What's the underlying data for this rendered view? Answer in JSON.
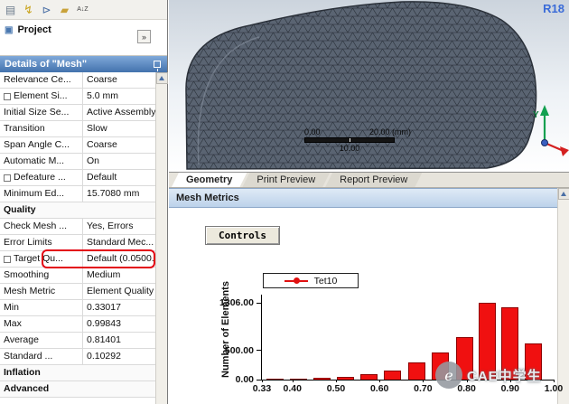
{
  "colors": {
    "details_header": "#4372ad",
    "highlight_box": "#e30613",
    "bar_color": "#f01010",
    "legend_line": "#e01010",
    "version_text": "#3a6bd8",
    "triad_y": "#12a050",
    "triad_x": "#d42020"
  },
  "toolbar": {
    "icons": [
      {
        "name": "worksheet-icon",
        "glyph": "▤",
        "color": "#6a7a8a",
        "size": 12
      },
      {
        "name": "solve-lightning-icon",
        "glyph": "↯",
        "color": "#caa41e",
        "size": 13
      },
      {
        "name": "show-errors-icon",
        "glyph": "⊳",
        "color": "#4a6fa5",
        "size": 12
      },
      {
        "name": "folder-icon",
        "glyph": "▰",
        "color": "#c9a23a",
        "size": 12
      },
      {
        "name": "az-sort-icon",
        "glyph": "A↓Z",
        "color": "#444444",
        "size": 7
      }
    ]
  },
  "outline": {
    "root_label": "Project",
    "expand_glyph": "»"
  },
  "details": {
    "title": "Details of \"Mesh\"",
    "rows": [
      {
        "label": "Relevance Ce...",
        "value": "Coarse"
      },
      {
        "label": "Element Si...",
        "value": "5.0 mm",
        "checkbox": true
      },
      {
        "label": "Initial Size Se...",
        "value": "Active Assembly"
      },
      {
        "label": "Transition",
        "value": "Slow"
      },
      {
        "label": "Span Angle C...",
        "value": "Coarse"
      },
      {
        "label": "Automatic M...",
        "value": "On"
      },
      {
        "label": "Defeature ...",
        "value": "Default",
        "checkbox": true
      },
      {
        "label": "Minimum Ed...",
        "value": "15.7080 mm"
      },
      {
        "label": "Quality",
        "section": true
      },
      {
        "label": "Check Mesh ...",
        "value": "Yes, Errors"
      },
      {
        "label": "Error Limits",
        "value": "Standard Mec..."
      },
      {
        "label": "Target Qu...",
        "value": "Default (0.0500...",
        "checkbox": true,
        "highlight": true
      },
      {
        "label": "Smoothing",
        "value": "Medium"
      },
      {
        "label": "Mesh Metric",
        "value": "Element Quality"
      },
      {
        "label": "Min",
        "value": "0.33017"
      },
      {
        "label": "Max",
        "value": "0.99843"
      },
      {
        "label": "Average",
        "value": "0.81401"
      },
      {
        "label": "Standard ...",
        "value": "0.10292"
      },
      {
        "label": "Inflation",
        "section": true
      },
      {
        "label": "Advanced",
        "section": true
      }
    ]
  },
  "viewport": {
    "version_label": "R18",
    "ruler": {
      "left": "0.00",
      "right": "20.00 (mm)",
      "center": "10.00"
    },
    "triad": {
      "y_label": "Y"
    }
  },
  "tabs": [
    {
      "label": "Geometry",
      "selected": true
    },
    {
      "label": "Print Preview",
      "selected": false
    },
    {
      "label": "Report Preview",
      "selected": false
    }
  ],
  "metrics_panel": {
    "title": "Mesh Metrics",
    "controls_button": "Controls"
  },
  "watermark": {
    "badge": "e",
    "text": "CAE中学生"
  },
  "chart_data": {
    "type": "bar",
    "legend": "Tet10",
    "ylabel": "Number of Elements",
    "x_range": [
      0.33,
      1.0
    ],
    "y_range": [
      0,
      1450
    ],
    "x_ticks": [
      "0.33",
      "0.40",
      "0.50",
      "0.60",
      "0.70",
      "0.80",
      "0.90",
      "1.00"
    ],
    "y_ticks": [
      "0.00",
      "500.00",
      "1306.00"
    ],
    "grid": false,
    "legend_position": "top-center",
    "bars": [
      {
        "x": 0.36,
        "value": 8
      },
      {
        "x": 0.413,
        "value": 15
      },
      {
        "x": 0.468,
        "value": 28
      },
      {
        "x": 0.522,
        "value": 48
      },
      {
        "x": 0.575,
        "value": 90
      },
      {
        "x": 0.63,
        "value": 160
      },
      {
        "x": 0.685,
        "value": 290
      },
      {
        "x": 0.74,
        "value": 470
      },
      {
        "x": 0.795,
        "value": 730
      },
      {
        "x": 0.848,
        "value": 1306
      },
      {
        "x": 0.9,
        "value": 1230
      },
      {
        "x": 0.953,
        "value": 610
      }
    ]
  }
}
